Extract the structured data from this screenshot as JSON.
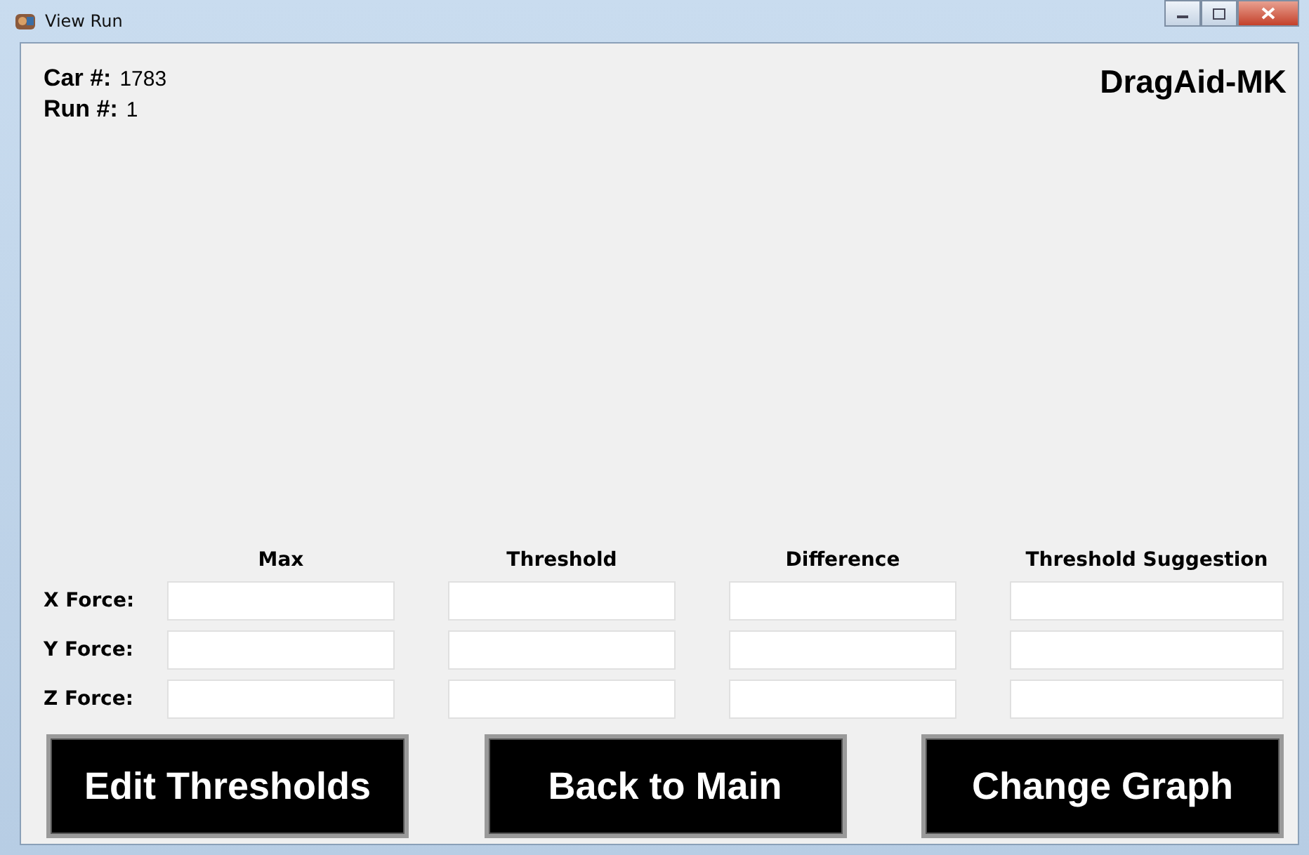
{
  "window": {
    "title": "View Run"
  },
  "info": [
    {
      "label": "Car #:",
      "value": "1783"
    },
    {
      "label": "Run #:",
      "value": "1"
    }
  ],
  "brand": "DragAid-MK",
  "table": {
    "columns": [
      "Max",
      "Threshold",
      "Difference",
      "Threshold Suggestion"
    ],
    "rows": [
      {
        "label": "X Force:"
      },
      {
        "label": "Y Force:"
      },
      {
        "label": "Z Force:"
      }
    ]
  },
  "buttons": [
    "Edit Thresholds",
    "Back to Main",
    "Change Graph"
  ]
}
